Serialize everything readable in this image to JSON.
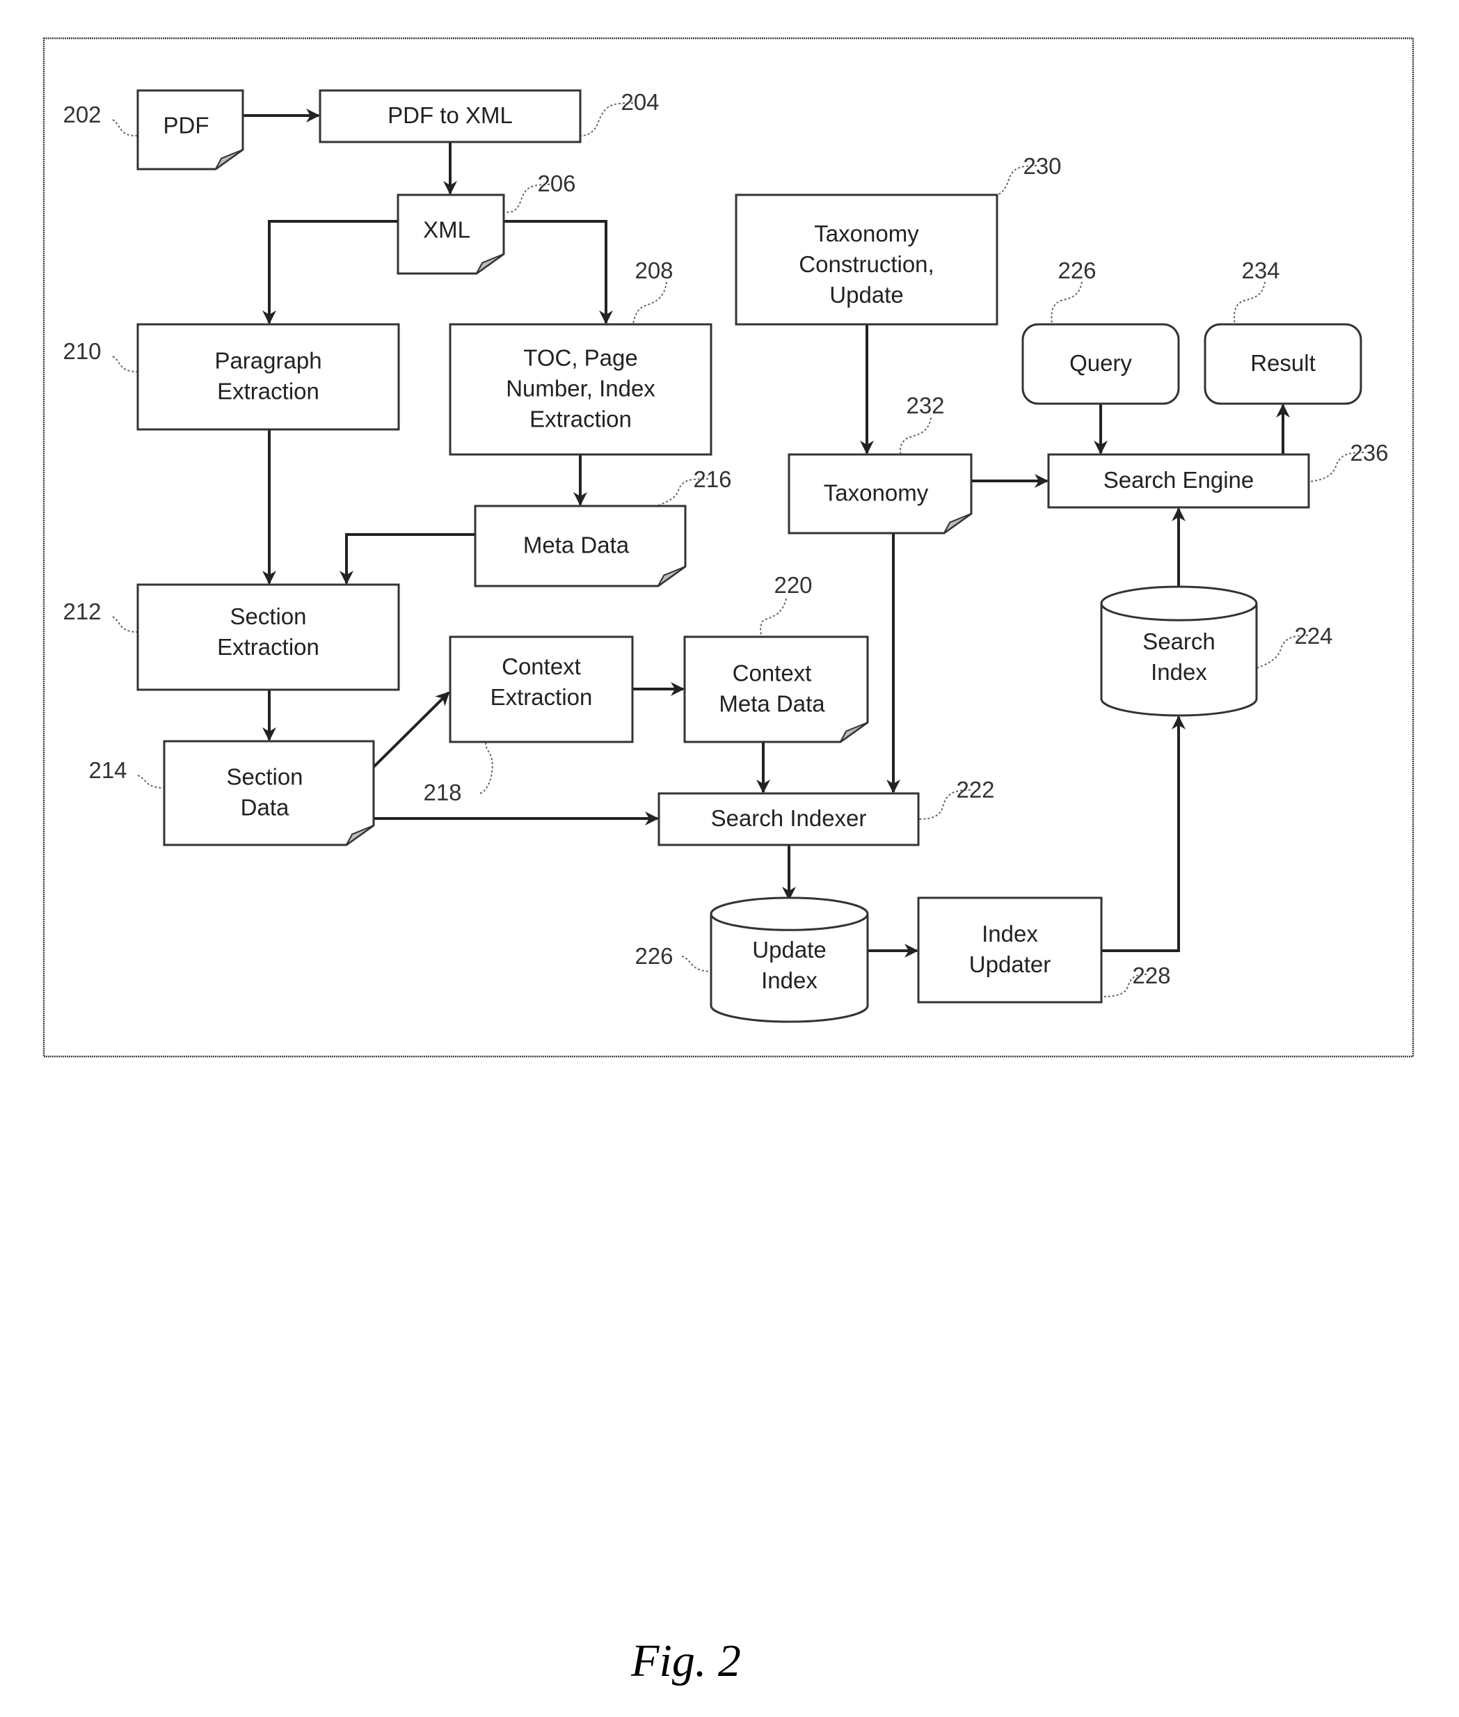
{
  "figure": {
    "caption": "Fig. 2"
  },
  "nodes": [
    {
      "id": "pdf",
      "ref": "202",
      "shape": "document",
      "lines": [
        "PDF"
      ]
    },
    {
      "id": "pdf-to-xml",
      "ref": "204",
      "shape": "process",
      "lines": [
        "PDF to XML"
      ]
    },
    {
      "id": "xml",
      "ref": "206",
      "shape": "document",
      "lines": [
        "XML"
      ]
    },
    {
      "id": "toc-extraction",
      "ref": "208",
      "shape": "process",
      "lines": [
        "TOC, Page",
        "Number, Index",
        "Extraction"
      ]
    },
    {
      "id": "paragraph-extraction",
      "ref": "210",
      "shape": "process",
      "lines": [
        "Paragraph",
        "Extraction"
      ]
    },
    {
      "id": "section-extraction",
      "ref": "212",
      "shape": "process",
      "lines": [
        "Section",
        "Extraction"
      ]
    },
    {
      "id": "section-data",
      "ref": "214",
      "shape": "document",
      "lines": [
        "Section",
        "Data"
      ]
    },
    {
      "id": "meta-data",
      "ref": "216",
      "shape": "document",
      "lines": [
        "Meta Data"
      ]
    },
    {
      "id": "context-extraction",
      "ref": "218",
      "shape": "process",
      "lines": [
        "Context",
        "Extraction"
      ]
    },
    {
      "id": "context-meta-data",
      "ref": "220",
      "shape": "document",
      "lines": [
        "Context",
        "Meta Data"
      ]
    },
    {
      "id": "search-indexer",
      "ref": "222",
      "shape": "process",
      "lines": [
        "Search Indexer"
      ]
    },
    {
      "id": "search-index",
      "ref": "224",
      "shape": "database",
      "lines": [
        "Search",
        "Index"
      ]
    },
    {
      "id": "update-index",
      "ref": "226",
      "shape": "database",
      "lines": [
        "Update",
        "Index"
      ]
    },
    {
      "id": "query",
      "ref": "226",
      "shape": "terminal",
      "lines": [
        "Query"
      ]
    },
    {
      "id": "index-updater",
      "ref": "228",
      "shape": "process",
      "lines": [
        "Index",
        "Updater"
      ]
    },
    {
      "id": "taxonomy-construction",
      "ref": "230",
      "shape": "process",
      "lines": [
        "Taxonomy",
        "Construction,",
        "Update"
      ]
    },
    {
      "id": "taxonomy",
      "ref": "232",
      "shape": "document",
      "lines": [
        "Taxonomy"
      ]
    },
    {
      "id": "result",
      "ref": "234",
      "shape": "terminal",
      "lines": [
        "Result"
      ]
    },
    {
      "id": "search-engine",
      "ref": "236",
      "shape": "process",
      "lines": [
        "Search Engine"
      ]
    }
  ],
  "edges": [
    {
      "from": "pdf",
      "to": "pdf-to-xml"
    },
    {
      "from": "pdf-to-xml",
      "to": "xml"
    },
    {
      "from": "xml",
      "to": "paragraph-extraction"
    },
    {
      "from": "xml",
      "to": "toc-extraction"
    },
    {
      "from": "toc-extraction",
      "to": "meta-data"
    },
    {
      "from": "paragraph-extraction",
      "to": "section-extraction"
    },
    {
      "from": "meta-data",
      "to": "section-extraction"
    },
    {
      "from": "section-extraction",
      "to": "section-data"
    },
    {
      "from": "section-data",
      "to": "context-extraction"
    },
    {
      "from": "section-data",
      "to": "search-indexer"
    },
    {
      "from": "context-extraction",
      "to": "context-meta-data"
    },
    {
      "from": "context-meta-data",
      "to": "search-indexer"
    },
    {
      "from": "taxonomy-construction",
      "to": "taxonomy"
    },
    {
      "from": "taxonomy",
      "to": "search-indexer"
    },
    {
      "from": "taxonomy",
      "to": "search-engine"
    },
    {
      "from": "search-indexer",
      "to": "update-index"
    },
    {
      "from": "update-index",
      "to": "index-updater"
    },
    {
      "from": "index-updater",
      "to": "search-index"
    },
    {
      "from": "search-index",
      "to": "search-engine"
    },
    {
      "from": "query",
      "to": "search-engine"
    },
    {
      "from": "search-engine",
      "to": "result"
    }
  ]
}
